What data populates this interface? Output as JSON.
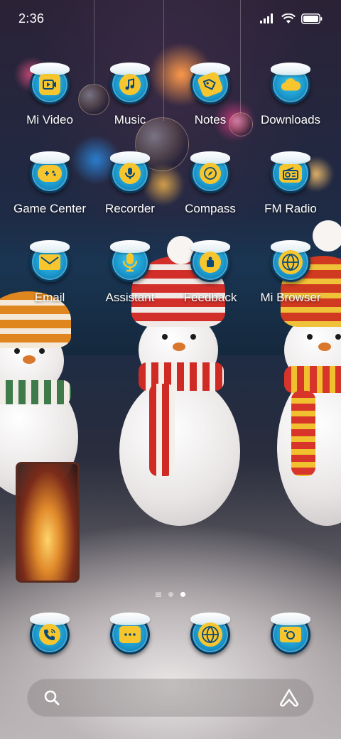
{
  "status_bar": {
    "time": "2:36",
    "icons": [
      "signal-icon",
      "wifi-icon",
      "battery-icon"
    ]
  },
  "apps": [
    {
      "label": "Mi Video",
      "icon": "video-icon"
    },
    {
      "label": "Music",
      "icon": "music-note-icon"
    },
    {
      "label": "Notes",
      "icon": "tag-icon"
    },
    {
      "label": "Downloads",
      "icon": "cloud-icon"
    },
    {
      "label": "Game Center",
      "icon": "gamepad-icon"
    },
    {
      "label": "Recorder",
      "icon": "microphone-disc-icon"
    },
    {
      "label": "Compass",
      "icon": "compass-icon"
    },
    {
      "label": "FM Radio",
      "icon": "radio-icon"
    },
    {
      "label": "Email",
      "icon": "envelope-icon"
    },
    {
      "label": "Assistant",
      "icon": "microphone-icon"
    },
    {
      "label": "Feedback",
      "icon": "feedback-icon"
    },
    {
      "label": "Mi Browser",
      "icon": "globe-icon"
    }
  ],
  "page_indicator": {
    "pages": 2,
    "current": 2
  },
  "dock": [
    {
      "name": "phone",
      "icon": "phone-icon"
    },
    {
      "name": "messages",
      "icon": "message-icon"
    },
    {
      "name": "browser",
      "icon": "globe-icon"
    },
    {
      "name": "camera",
      "icon": "camera-icon"
    }
  ],
  "colors": {
    "icon_ring": "#1b97cc",
    "icon_glyph_bg": "#f7c62e",
    "icon_glyph": "#0b4a78"
  },
  "search": {
    "icons": [
      "search-icon",
      "assistant-icon"
    ]
  }
}
